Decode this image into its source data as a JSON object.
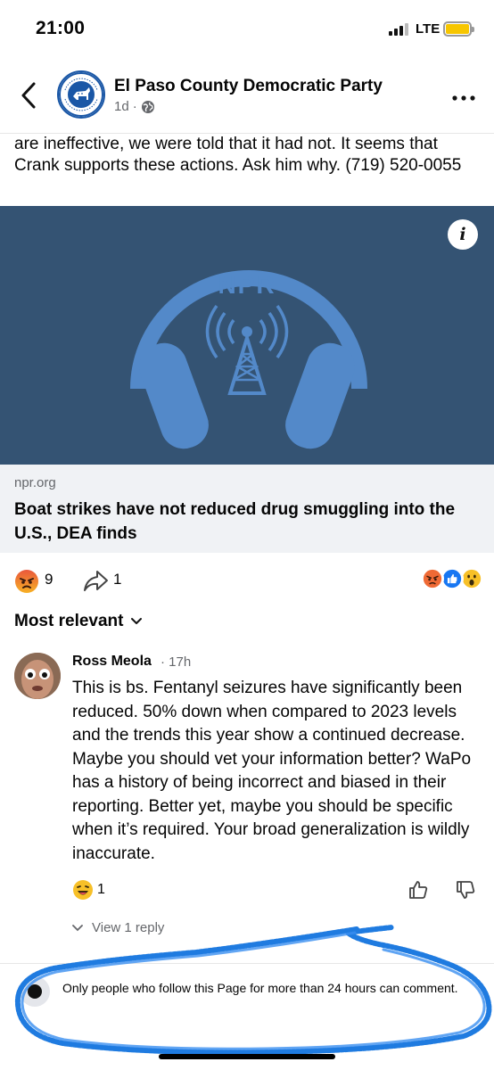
{
  "status_bar": {
    "time": "21:00",
    "network": "LTE",
    "battery_color": "#f7c600"
  },
  "post": {
    "page_name": "El Paso County Democratic Party",
    "time": "1d",
    "separator": "·",
    "privacy_icon": "globe-icon",
    "avatar_text": "EL PASO COUNTY DEMOCRATIC PARTY",
    "text": "are ineffective, we were told that it had not.  It seems that Crank supports these actions. Ask him why.  (719) 520-0055",
    "link": {
      "image_logo": "NPR",
      "image_bg": "#345373",
      "domain": "npr.org",
      "title": "Boat strikes have not reduced drug smuggling into the U.S., DEA finds"
    },
    "reactions": {
      "count": "9",
      "share_count": "1"
    }
  },
  "comments": {
    "sort_label": "Most relevant",
    "items": [
      {
        "author": "Ross Meola",
        "time": "· 17h",
        "text": "This is bs. Fentanyl seizures have significantly been reduced. 50% down when compared to 2023 levels and the trends this year show a continued decrease. Maybe you should vet your information better? WaPo has a history of being incorrect and biased in their reporting. Better yet, maybe you should be specific when it’s required. Your broad generalization is wildly inaccurate.",
        "reaction_count": "1",
        "view_replies": "View 1 reply"
      }
    ]
  },
  "footer": {
    "restriction_text": "Only people who follow this Page for more than 24 hours can comment.",
    "annotation_color": "#1f7be0"
  }
}
